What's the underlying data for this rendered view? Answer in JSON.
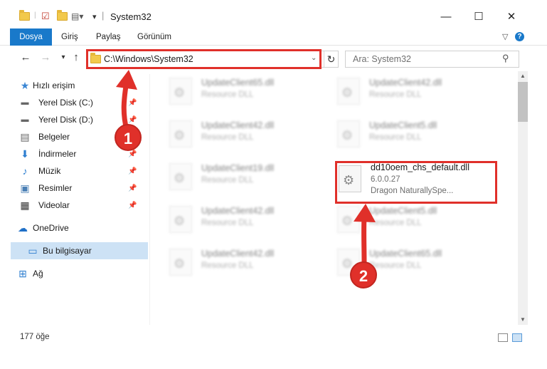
{
  "window": {
    "title": "System32"
  },
  "ribbon": {
    "tabs": [
      "Dosya",
      "Giriş",
      "Paylaş",
      "Görünüm"
    ]
  },
  "address": {
    "path": "C:\\Windows\\System32"
  },
  "search": {
    "placeholder": "Ara: System32"
  },
  "nav": {
    "items": [
      {
        "label": "Hızlı erişim",
        "icon": "star-icon"
      },
      {
        "label": "Yerel Disk (C:)",
        "icon": "drive-icon",
        "pinned": true
      },
      {
        "label": "Yerel Disk (D:)",
        "icon": "drive-icon",
        "pinned": true
      },
      {
        "label": "Belgeler",
        "icon": "document-icon",
        "pinned": true
      },
      {
        "label": "İndirmeler",
        "icon": "download-icon",
        "pinned": true
      },
      {
        "label": "Müzik",
        "icon": "music-icon",
        "pinned": true
      },
      {
        "label": "Resimler",
        "icon": "pictures-icon",
        "pinned": true
      },
      {
        "label": "Videolar",
        "icon": "video-icon",
        "pinned": true
      },
      {
        "label": "OneDrive",
        "icon": "cloud-icon"
      },
      {
        "label": "Bu bilgisayar",
        "icon": "computer-icon",
        "selected": true
      },
      {
        "label": "Ağ",
        "icon": "network-icon"
      }
    ]
  },
  "files": [
    {
      "name": "UpdateClient65.dll",
      "type": "Resource DLL"
    },
    {
      "name": "UpdateClient42.dll",
      "type": "Resource DLL"
    },
    {
      "name": "UpdateClient42.dll",
      "type": "Resource DLL"
    },
    {
      "name": "UpdateClient5.dll",
      "type": "Resource DLL"
    },
    {
      "name": "UpdateClient19.dll",
      "type": "Resource DLL"
    },
    {
      "name": "dd10oem_chs_default.dll",
      "version": "6.0.0.27",
      "company": "Dragon NaturallySpe..."
    },
    {
      "name": "UpdateClient42.dll",
      "type": "Resource DLL"
    },
    {
      "name": "UpdateClient5.dll",
      "type": "Resource DLL"
    },
    {
      "name": "UpdateClient42.dll",
      "type": "Resource DLL"
    },
    {
      "name": "UpdateClient65.dll",
      "type": "Resource DLL"
    }
  ],
  "status": {
    "count": "177 öğe"
  },
  "annotations": {
    "badge1": "1",
    "badge2": "2",
    "color": "#e0302a"
  }
}
